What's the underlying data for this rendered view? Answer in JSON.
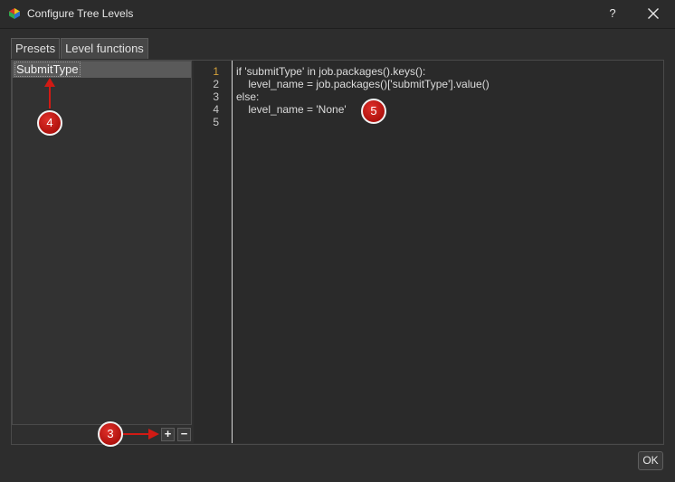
{
  "window": {
    "title": "Configure Tree Levels",
    "help_label": "?"
  },
  "tabs": [
    {
      "label": "Presets"
    },
    {
      "label": "Level functions"
    }
  ],
  "levels_list": {
    "items": [
      "SubmitType"
    ]
  },
  "list_buttons": {
    "add": "+",
    "remove": "−"
  },
  "editor": {
    "line_numbers": [
      "1",
      "2",
      "3",
      "4",
      "5"
    ],
    "lines": [
      "if 'submitType' in job.packages().keys():",
      "    level_name = job.packages()['submitType'].value()",
      "else:",
      "    level_name = 'None'",
      ""
    ],
    "current_line": 1
  },
  "footer": {
    "ok_label": "OK"
  },
  "callouts": [
    "4",
    "5",
    "3"
  ],
  "colors": {
    "callout": "#c8160f",
    "current_line_number": "#d4a13a"
  }
}
